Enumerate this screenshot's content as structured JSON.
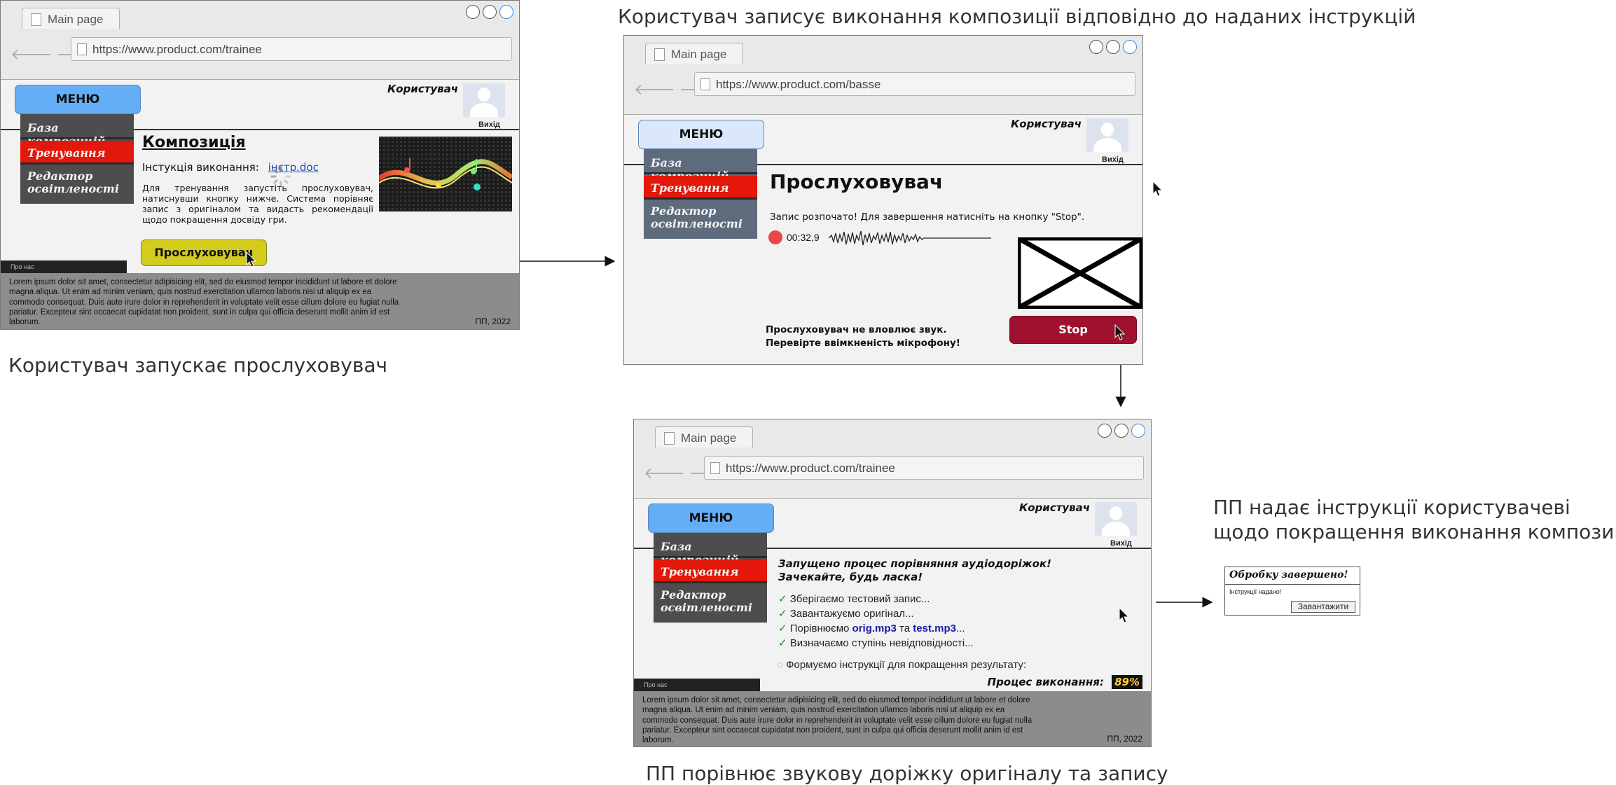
{
  "captions": {
    "step1": "Користувач запускає прослуховувач",
    "step2": "Користувач записує виконання композиції відповідно до наданих інструкцій",
    "step3": "ПП порівнює звукову доріжку оригіналу та запису",
    "step4_line1": "ПП надає інструкції користувачеві",
    "step4_line2": "щодо покращення виконання композиції"
  },
  "common": {
    "tab_title": "Main page",
    "menu_label": "МЕНЮ",
    "user_label": "Користувач",
    "exit_label": "Вихід",
    "sidebar": [
      "База композицій",
      "Тренування",
      "Редактор освітленості"
    ],
    "about_label": "Про нас",
    "footer_text": "Lorem ipsum dolor sit amet, consectetur adipisicing elit, sed do eiusmod tempor incididunt ut labore et dolore magna aliqua. Ut enim ad minim veniam, quis nostrud exercitation ullamco laboris nisi ut aliquip ex ea commodo consequat. Duis aute irure dolor in reprehenderit in voluptate velit esse cillum dolore eu fugiat nulla pariatur. Excepteur sint occaecat cupidatat non proident, sunt in culpa qui officia deserunt mollit anim id est laborum.",
    "footer_year": "ПП, 2022"
  },
  "window1": {
    "url": "https://www.product.com/trainee",
    "heading": "Композиція",
    "instruction_label": "Інстукція виконання:",
    "instruction_link": "інстр.doc",
    "body_text": "Для тренування запустіть прослуховувач, натиснувши кнопку нижче. Система порівняє запис з оригіналом та видасть рекомендації щодо покращення досвіду гри.",
    "listen_button": "Прослуховувач"
  },
  "window2": {
    "url": "https://www.product.com/basse",
    "heading": "Прослуховувач",
    "status_text": "Запис розпочато! Для завершення натисніть на кнопку \"Stop\".",
    "timer": "00:32,9",
    "warning_line1": "Прослуховувач не вловлює звук.",
    "warning_line2": "Перевірте ввімкненість мікрофону!",
    "stop_button": "Stop"
  },
  "window3": {
    "url": "https://www.product.com/trainee",
    "title_line1": "Запущено процес порівняння аудіодоріжок!",
    "title_line2": "Зачекайте, будь ласка!",
    "steps": [
      {
        "text": "Зберігаємо тестовий запис..."
      },
      {
        "text": "Завантажуємо оригінал..."
      },
      {
        "pre": "Порівнюємо ",
        "file1": "orig.mp3",
        "mid": " та ",
        "file2": "test.mp3",
        "post": "..."
      },
      {
        "text": "Визначаємо ступінь невідповідності..."
      }
    ],
    "forming_text": "Формуємо інструкції для покращення результату:",
    "progress_label": "Процес виконання:",
    "progress_value": "89%"
  },
  "dialog": {
    "title": "Обробку завершено!",
    "message": "Інструкції надано!",
    "button": "Завантажити"
  }
}
